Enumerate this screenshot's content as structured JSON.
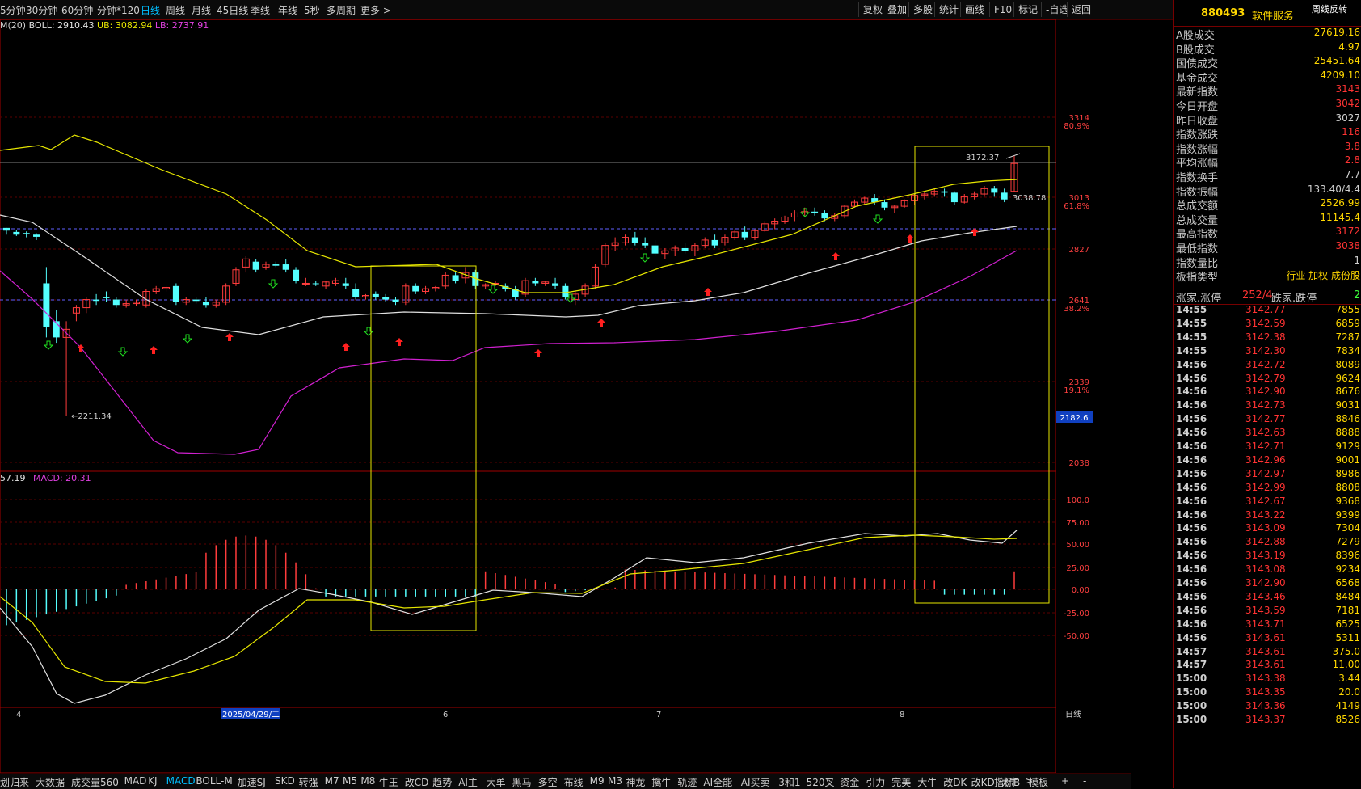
{
  "topbar": {
    "periods": [
      "5分钟",
      "30分钟",
      "60分钟",
      "分钟*120",
      "日线",
      "周线",
      "月线",
      "45日线",
      "季线",
      "年线",
      "5秒",
      "多周期",
      "更多 >"
    ],
    "active_period": "日线",
    "right_buttons": [
      "复权",
      "叠加",
      "多股",
      "统计",
      "画线",
      "F10",
      "标记",
      "-自选",
      "返回"
    ]
  },
  "indicator_line": {
    "prefix": "M(20)",
    "boll_label": "BOLL: 2910.43",
    "ub_label": "UB: 3082.94",
    "lb_label": "LB: 2737.91"
  },
  "macd_line": {
    "dif_label": "57.19",
    "macd_label": "MACD: 20.31"
  },
  "price_annotations": {
    "high": "3172.37",
    "low_close": "3038.78",
    "min": "←2211.34",
    "cursor_price": "2182.6"
  },
  "right_axis": {
    "price_ticks": [
      {
        "v": "3314",
        "pct": "80.9%"
      },
      {
        "v": "3013",
        "pct": "61.8%"
      },
      {
        "v": "2827",
        "pct": ""
      },
      {
        "v": "2641",
        "pct": "38.2%"
      },
      {
        "v": "2339",
        "pct": "19.1%"
      },
      {
        "v": "2038",
        "pct": ""
      }
    ],
    "macd_ticks": [
      "100.0",
      "75.00",
      "50.00",
      "25.00",
      "0.00",
      "-25.00",
      "-50.00"
    ]
  },
  "x_axis": {
    "labels": [
      "4",
      "2025/04/29/二",
      "6",
      "7",
      "8"
    ],
    "period_label": "日线"
  },
  "right_panel": {
    "code": "880493",
    "name": "软件服务",
    "tag": "周线反转",
    "stats": [
      {
        "label": "A股成交",
        "value": "27619.16",
        "color": "#ffd700"
      },
      {
        "label": "B股成交",
        "value": "4.97",
        "color": "#ffd700"
      },
      {
        "label": "国债成交",
        "value": "25451.64",
        "color": "#ffd700"
      },
      {
        "label": "基金成交",
        "value": "4209.10",
        "color": "#ffd700"
      },
      {
        "label": "最新指数",
        "value": "3143",
        "color": "#ff3333"
      },
      {
        "label": "今日开盘",
        "value": "3042",
        "color": "#ff3333"
      },
      {
        "label": "昨日收盘",
        "value": "3027",
        "color": "#d0d0d0"
      },
      {
        "label": "指数涨跌",
        "value": "116",
        "color": "#ff3333"
      },
      {
        "label": "指数涨幅",
        "value": "3.8",
        "color": "#ff3333"
      },
      {
        "label": "平均涨幅",
        "value": "2.8",
        "color": "#ff3333"
      },
      {
        "label": "指数换手",
        "value": "7.7",
        "color": "#d0d0d0"
      },
      {
        "label": "指数振幅",
        "value": "133.40/4.4",
        "color": "#d0d0d0"
      },
      {
        "label": "总成交额",
        "value": "2526.99",
        "color": "#ffd700"
      },
      {
        "label": "总成交量",
        "value": "11145.4",
        "color": "#ffd700"
      },
      {
        "label": "最高指数",
        "value": "3172",
        "color": "#ff3333"
      },
      {
        "label": "最低指数",
        "value": "3038",
        "color": "#ff3333"
      },
      {
        "label": "指数量比",
        "value": "1",
        "color": "#d0d0d0"
      },
      {
        "label": "板指类型",
        "value": "行业 加权 成份股",
        "color": "#ffd700"
      }
    ],
    "updown": {
      "label": "涨家.涨停",
      "value": "252/4",
      "label2": "跌家.跌停",
      "value2": "2"
    },
    "ticks": [
      {
        "t": "14:55",
        "p": "3142.77",
        "v": "7855"
      },
      {
        "t": "14:55",
        "p": "3142.59",
        "v": "6859"
      },
      {
        "t": "14:55",
        "p": "3142.38",
        "v": "7287"
      },
      {
        "t": "14:55",
        "p": "3142.30",
        "v": "7834"
      },
      {
        "t": "14:56",
        "p": "3142.72",
        "v": "8089"
      },
      {
        "t": "14:56",
        "p": "3142.79",
        "v": "9624"
      },
      {
        "t": "14:56",
        "p": "3142.90",
        "v": "8676"
      },
      {
        "t": "14:56",
        "p": "3142.73",
        "v": "9031"
      },
      {
        "t": "14:56",
        "p": "3142.77",
        "v": "8846"
      },
      {
        "t": "14:56",
        "p": "3142.63",
        "v": "8888"
      },
      {
        "t": "14:56",
        "p": "3142.71",
        "v": "9129"
      },
      {
        "t": "14:56",
        "p": "3142.96",
        "v": "9001"
      },
      {
        "t": "14:56",
        "p": "3142.97",
        "v": "8986"
      },
      {
        "t": "14:56",
        "p": "3142.99",
        "v": "8808"
      },
      {
        "t": "14:56",
        "p": "3142.67",
        "v": "9368"
      },
      {
        "t": "14:56",
        "p": "3143.22",
        "v": "9399"
      },
      {
        "t": "14:56",
        "p": "3143.09",
        "v": "7304"
      },
      {
        "t": "14:56",
        "p": "3142.88",
        "v": "7279"
      },
      {
        "t": "14:56",
        "p": "3143.19",
        "v": "8396"
      },
      {
        "t": "14:56",
        "p": "3143.08",
        "v": "9234"
      },
      {
        "t": "14:56",
        "p": "3142.90",
        "v": "6568"
      },
      {
        "t": "14:56",
        "p": "3143.46",
        "v": "8484"
      },
      {
        "t": "14:56",
        "p": "3143.59",
        "v": "7181"
      },
      {
        "t": "14:56",
        "p": "3143.71",
        "v": "6525"
      },
      {
        "t": "14:56",
        "p": "3143.61",
        "v": "5311"
      },
      {
        "t": "14:57",
        "p": "3143.61",
        "v": "375.0"
      },
      {
        "t": "14:57",
        "p": "3143.61",
        "v": "11.00"
      },
      {
        "t": "15:00",
        "p": "3143.38",
        "v": "3.44"
      },
      {
        "t": "15:00",
        "p": "3143.35",
        "v": "20.0"
      },
      {
        "t": "15:00",
        "p": "3143.36",
        "v": "4149"
      },
      {
        "t": "15:00",
        "p": "3143.37",
        "v": "8526"
      }
    ]
  },
  "bottombar": {
    "items": [
      "划归来",
      "大数据",
      "成交量560",
      "MAD",
      "KJ",
      "MACD",
      "BOLL-M",
      "加速SJ",
      "SKD",
      "转强",
      "M7",
      "M5",
      "M8",
      "牛王",
      "改CD",
      "趋势",
      "AI主",
      "大单",
      "黑马",
      "多空",
      "布线",
      "M9",
      "M3",
      "神龙",
      "擒牛",
      "轨迹",
      "AI全能",
      "AI买卖",
      "3和1",
      "520叉",
      "资金",
      "引力",
      "完美",
      "大牛",
      "改DK",
      "改KD",
      "伏牛",
      ">"
    ],
    "active": "MACD",
    "right_items": [
      "指标B",
      "模板",
      "+",
      "-"
    ]
  },
  "chart_data": {
    "type": "candlestick",
    "price_axis": {
      "ticks": [
        3314,
        3013,
        2827,
        2641,
        2339,
        2038
      ]
    },
    "macd_axis": {
      "ticks": [
        100,
        75,
        50,
        25,
        0,
        -25,
        -50
      ]
    },
    "colors": {
      "up": "#ff3c3c",
      "down": "#54ffff",
      "mid": "#e0e0e0",
      "ub": "#e6e600",
      "lb": "#d020d0",
      "dif": "#e0e0e0",
      "dea": "#e6e600"
    }
  }
}
